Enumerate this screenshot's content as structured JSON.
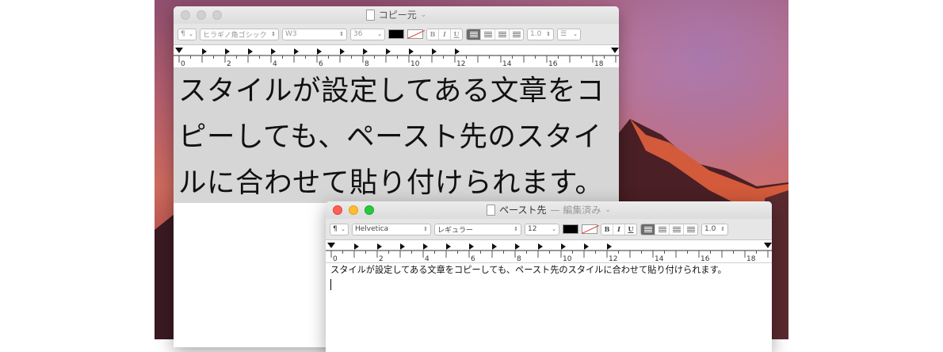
{
  "copy_window": {
    "title": "コピー元",
    "toolbar": {
      "paragraph_style": "¶",
      "font_family": "ヒラギノ角ゴシック",
      "font_weight": "W3",
      "font_size": "36",
      "bold": "B",
      "italic": "I",
      "underline": "U",
      "line_spacing": "1.0"
    },
    "ruler_labels": [
      "0",
      "2",
      "4",
      "6",
      "8",
      "10",
      "12",
      "14",
      "16",
      "18"
    ],
    "body_lines": [
      "スタイルが設定してある文章をコ",
      "ピーしても、ペースト先のスタイ",
      "ルに合わせて貼り付けられます。"
    ]
  },
  "paste_window": {
    "title": "ペースト先",
    "status": "— 編集済み",
    "toolbar": {
      "paragraph_style": "¶",
      "font_family": "Helvetica",
      "font_weight": "レギュラー",
      "font_size": "12",
      "bold": "B",
      "italic": "I",
      "underline": "U",
      "line_spacing": "1.0"
    },
    "ruler_labels": [
      "0",
      "2",
      "4",
      "6",
      "8",
      "10",
      "12",
      "14",
      "16",
      "18"
    ],
    "body_text": "スタイルが設定してある文章をコピーしても、ペースト先のスタイルに合わせて貼り付けられます。"
  }
}
